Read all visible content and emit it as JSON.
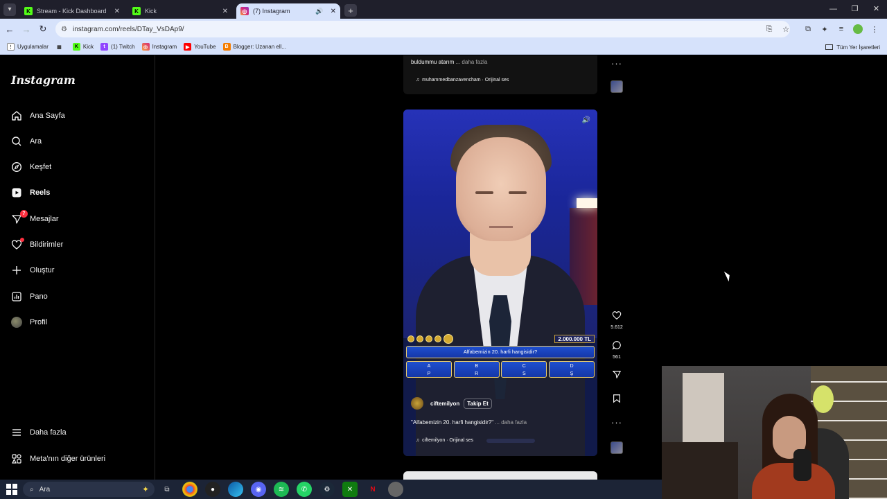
{
  "browser": {
    "tabs": [
      {
        "title": "Stream - Kick Dashboard",
        "icon": "kick-icon",
        "active": false
      },
      {
        "title": "Kick",
        "icon": "kick-icon",
        "active": false
      },
      {
        "title": "(7) Instagram",
        "icon": "instagram-icon",
        "active": true
      }
    ],
    "url": "instagram.com/reels/DTay_VsDAp9/",
    "bookmarks": [
      {
        "label": "Uygulamalar",
        "icon": "apps-icon"
      },
      {
        "label": "",
        "icon": "grid-icon"
      },
      {
        "label": "Kick",
        "icon": "kick-icon"
      },
      {
        "label": "(1) Twitch",
        "icon": "twitch-icon"
      },
      {
        "label": "Instagram",
        "icon": "instagram-icon"
      },
      {
        "label": "YouTube",
        "icon": "youtube-icon"
      },
      {
        "label": "Blogger: Uzanan ell...",
        "icon": "blogger-icon"
      }
    ],
    "all_bookmarks_label": "Tüm Yer İşaretleri"
  },
  "sidebar": {
    "logo": "Instagram",
    "items": [
      {
        "label": "Ana Sayfa",
        "icon": "home-icon"
      },
      {
        "label": "Ara",
        "icon": "search-icon"
      },
      {
        "label": "Keşfet",
        "icon": "compass-icon"
      },
      {
        "label": "Reels",
        "icon": "reels-icon"
      },
      {
        "label": "Mesajlar",
        "icon": "messenger-icon",
        "badge": "7"
      },
      {
        "label": "Bildirimler",
        "icon": "heart-icon"
      },
      {
        "label": "Oluştur",
        "icon": "plus-icon"
      },
      {
        "label": "Pano",
        "icon": "dashboard-icon"
      },
      {
        "label": "Profil",
        "icon": "profile-avatar"
      }
    ],
    "more_label": "Daha fazla",
    "meta_label": "Meta'nın diğer ürünleri"
  },
  "previous_reel": {
    "caption": "buldummu atarım",
    "more": "... daha fazla",
    "audio": "muhammedbanzavencham · Orijinal ses"
  },
  "reel": {
    "prize": "2.000.000 TL",
    "question": "Alfabemizin 20. harfi hangisidir?",
    "answers": [
      {
        "key": "A",
        "value": "P"
      },
      {
        "key": "B",
        "value": "R"
      },
      {
        "key": "C",
        "value": "S"
      },
      {
        "key": "D",
        "value": "Ş"
      }
    ],
    "channel": "ciftemilyon",
    "follow_label": "Takip Et",
    "caption": "\"Alfabemizin 20. harfi hangisidir?\"",
    "more": "... daha fazla",
    "audio": "ciftemilyon · Orijinal ses",
    "likes": "5.612",
    "comments": "561"
  },
  "taskbar": {
    "search_placeholder": "Ara"
  },
  "colors": {
    "accent_blue": "#0095f6",
    "notification_red": "#ff3040",
    "browser_chrome": "#d6e2fb"
  }
}
